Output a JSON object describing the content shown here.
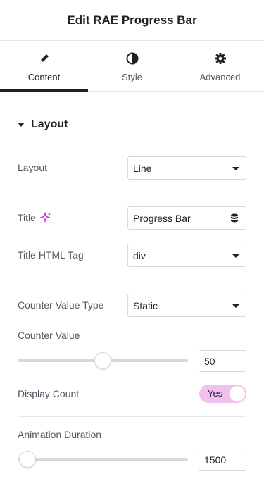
{
  "header": {
    "title": "Edit RAE Progress Bar"
  },
  "tabs": [
    {
      "label": "Content",
      "icon": "pencil-icon",
      "active": true
    },
    {
      "label": "Style",
      "icon": "half-circle-icon",
      "active": false
    },
    {
      "label": "Advanced",
      "icon": "gear-icon",
      "active": false
    }
  ],
  "section": {
    "title": "Layout"
  },
  "fields": {
    "layout": {
      "label": "Layout",
      "value": "Line"
    },
    "title": {
      "label": "Title",
      "value": "Progress Bar",
      "ai_icon": "sparkle-icon",
      "dynamic_icon": "database-icon"
    },
    "title_tag": {
      "label": "Title HTML Tag",
      "value": "div"
    },
    "counter_type": {
      "label": "Counter Value Type",
      "value": "Static"
    },
    "counter_value": {
      "label": "Counter Value",
      "value": "50",
      "slider_fraction": 0.5
    },
    "display_count": {
      "label": "Display Count",
      "value": "Yes"
    },
    "animation_duration": {
      "label": "Animation Duration",
      "value": "1500",
      "slider_fraction": 0.058
    }
  },
  "colors": {
    "accent": "#f0c0f0",
    "sparkle": "#c026d3"
  }
}
